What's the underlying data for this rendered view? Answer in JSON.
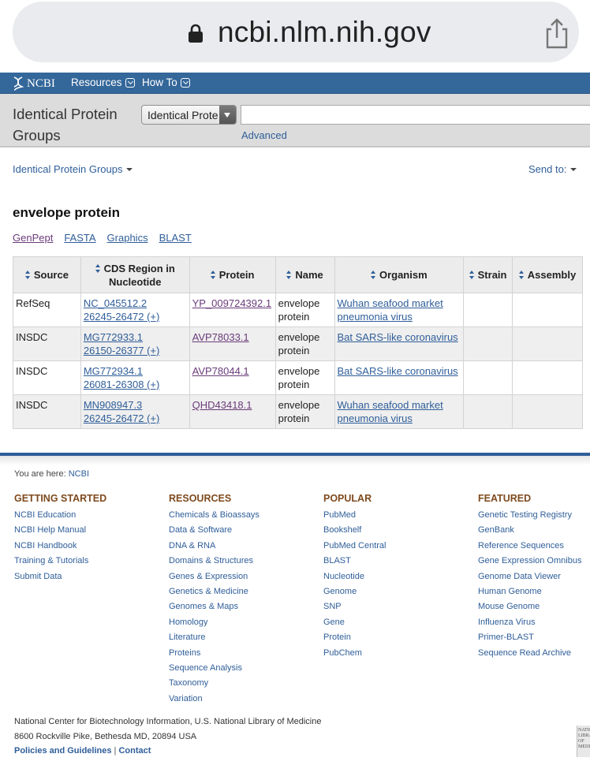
{
  "browser": {
    "url": "ncbi.nlm.nih.gov"
  },
  "topnav": {
    "logo": "NCBI",
    "items": [
      {
        "label": "Resources"
      },
      {
        "label": "How To"
      }
    ]
  },
  "search": {
    "db_title": "Identical Protein Groups",
    "db_selected": "Identical Protein Groups",
    "query": "",
    "advanced": "Advanced"
  },
  "subheader": {
    "breadcrumb": "Identical Protein Groups",
    "send_to": "Send to:"
  },
  "page": {
    "title": "envelope protein",
    "view_links": [
      "GenPept",
      "FASTA",
      "Graphics",
      "BLAST"
    ]
  },
  "table": {
    "columns": [
      "Source",
      "CDS Region in Nucleotide",
      "Protein",
      "Name",
      "Organism",
      "Strain",
      "Assembly"
    ],
    "rows": [
      {
        "source": "RefSeq",
        "cds_acc": "NC_045512.2",
        "cds_range": "26245-26472 (+)",
        "protein": "YP_009724392.1",
        "name": "envelope protein",
        "organism": "Wuhan seafood market pneumonia virus",
        "strain": "",
        "assembly": ""
      },
      {
        "source": "INSDC",
        "cds_acc": "MG772933.1",
        "cds_range": "26150-26377 (+)",
        "protein": "AVP78033.1",
        "name": "envelope protein",
        "organism": "Bat SARS-like coronavirus",
        "strain": "",
        "assembly": ""
      },
      {
        "source": "INSDC",
        "cds_acc": "MG772934.1",
        "cds_range": "26081-26308 (+)",
        "protein": "AVP78044.1",
        "name": "envelope protein",
        "organism": "Bat SARS-like coronavirus",
        "strain": "",
        "assembly": ""
      },
      {
        "source": "INSDC",
        "cds_acc": "MN908947.3",
        "cds_range": "26245-26472 (+)",
        "protein": "QHD43418.1",
        "name": "envelope protein",
        "organism": "Wuhan seafood market pneumonia virus",
        "strain": "",
        "assembly": ""
      }
    ]
  },
  "footer": {
    "you_are_here": "You are here:",
    "here_link": "NCBI",
    "columns": [
      {
        "heading": "GETTING STARTED",
        "items": [
          "NCBI Education",
          "NCBI Help Manual",
          "NCBI Handbook",
          "Training & Tutorials",
          "Submit Data"
        ]
      },
      {
        "heading": "RESOURCES",
        "items": [
          "Chemicals & Bioassays",
          "Data & Software",
          "DNA & RNA",
          "Domains & Structures",
          "Genes & Expression",
          "Genetics & Medicine",
          "Genomes & Maps",
          "Homology",
          "Literature",
          "Proteins",
          "Sequence Analysis",
          "Taxonomy",
          "Variation"
        ]
      },
      {
        "heading": "POPULAR",
        "items": [
          "PubMed",
          "Bookshelf",
          "PubMed Central",
          "BLAST",
          "Nucleotide",
          "Genome",
          "SNP",
          "Gene",
          "Protein",
          "PubChem"
        ]
      },
      {
        "heading": "FEATURED",
        "items": [
          "Genetic Testing Registry",
          "GenBank",
          "Reference Sequences",
          "Gene Expression Omnibus",
          "Genome Data Viewer",
          "Human Genome",
          "Mouse Genome",
          "Influenza Virus",
          "Primer-BLAST",
          "Sequence Read Archive"
        ]
      }
    ],
    "org_line": "National Center for Biotechnology Information, U.S. National Library of Medicine",
    "address": "8600 Rockville Pike, Bethesda MD, 20894 USA",
    "policies": "Policies and Guidelines",
    "separator": "|",
    "contact": "Contact",
    "nlm_logo_text": "NATIONAL LIBRARY OF MEDICINE"
  },
  "colors": {
    "nav_bg": "#34679a",
    "link": "#2f5e99",
    "visited": "#6a3b7a",
    "footer_heading": "#7f4a1e"
  }
}
